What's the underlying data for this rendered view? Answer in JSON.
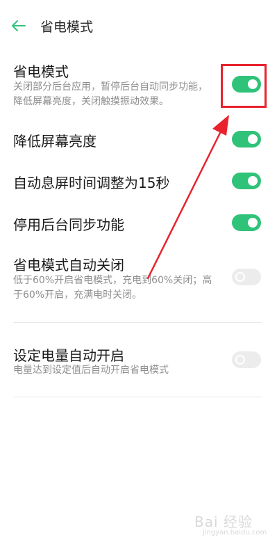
{
  "header": {
    "back_icon": "arrow-left-icon",
    "title": "省电模式"
  },
  "colors": {
    "accent": "#2fc37a",
    "toggle_off": "#ececec",
    "annotation": "#e8232d",
    "secondary_text": "#8e8e8e"
  },
  "settings": [
    {
      "title": "省电模式",
      "description": "关闭部分后台应用，暂停后台自动同步功能，降低屏幕亮度，关闭触摸振动效果。",
      "enabled": true
    },
    {
      "title": "降低屏幕亮度",
      "description": "",
      "enabled": true
    },
    {
      "title": "自动息屏时间调整为15秒",
      "description": "",
      "enabled": true
    },
    {
      "title": "停用后台同步功能",
      "description": "",
      "enabled": true
    },
    {
      "title": "省电模式自动关闭",
      "description": "低于60%开启省电模式，充电到60%关闭；高于60%开启，充满电时关闭。",
      "enabled": false
    },
    {
      "title": "设定电量自动开启",
      "description": "电量达到设定值后自动开启省电模式",
      "enabled": false
    }
  ],
  "watermark": {
    "logo": "Bai 经验",
    "url": "jingyan.baidu.com"
  }
}
